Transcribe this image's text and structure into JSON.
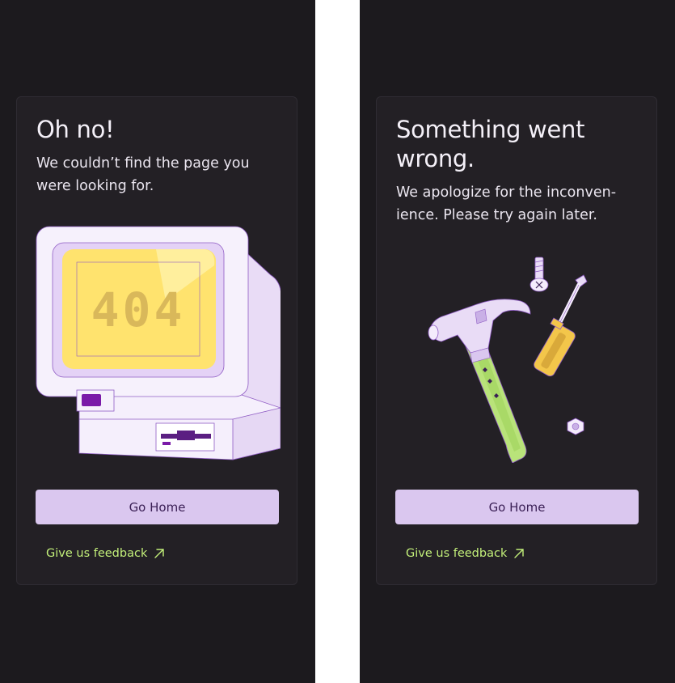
{
  "screens": [
    {
      "title": "Oh no!",
      "description": "We couldn’t find the page you were looking for.",
      "illustration": "retro-computer-404",
      "illustration_text": "404",
      "button_label": "Go Home",
      "feedback_label": "Give us feedback",
      "feedback_icon": "arrow-up-right-icon"
    },
    {
      "title": "Something went wrong.",
      "description": "We apologize for the inconven-ience. Please try again later.",
      "illustration": "hammer-screwdriver-tools",
      "button_label": "Go Home",
      "feedback_label": "Give us feedback",
      "feedback_icon": "arrow-up-right-icon"
    }
  ],
  "colors": {
    "background": "#1c1a1e",
    "card": "#232025",
    "button": "#dac7ef",
    "button_text": "#3a1f55",
    "link": "#c3f07a",
    "screen_yellow": "#ffe36e",
    "accent_purple": "#7a1aa8"
  }
}
